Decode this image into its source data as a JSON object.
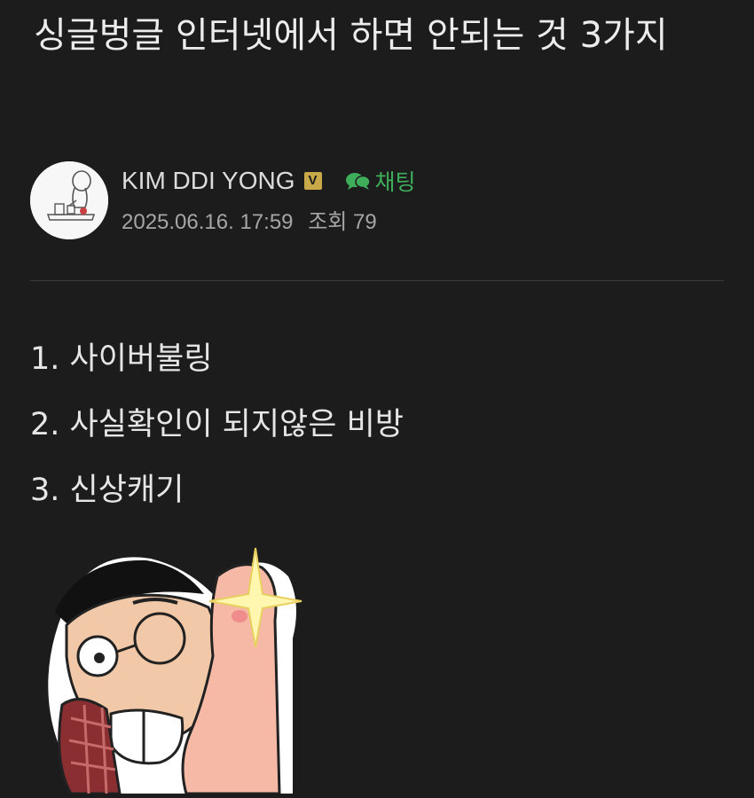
{
  "post": {
    "title": "싱글벙글 인터넷에서 하면 안되는 것 3가지"
  },
  "author": {
    "name": "KIM DDI YONG",
    "badge": "V",
    "chat_label": "채팅",
    "date": "2025.06.16. 17:59",
    "views_label": "조회 79"
  },
  "body": {
    "items": [
      "1. 사이버불링",
      "2. 사실확인이 되지않은 비방",
      "3. 신상캐기"
    ]
  },
  "colors": {
    "background": "#1c1c1c",
    "chat_green": "#3fae5a",
    "badge_gold": "#c8a848"
  },
  "icons": {
    "chat": "chat-bubbles-icon",
    "verified": "verified-badge-icon"
  }
}
